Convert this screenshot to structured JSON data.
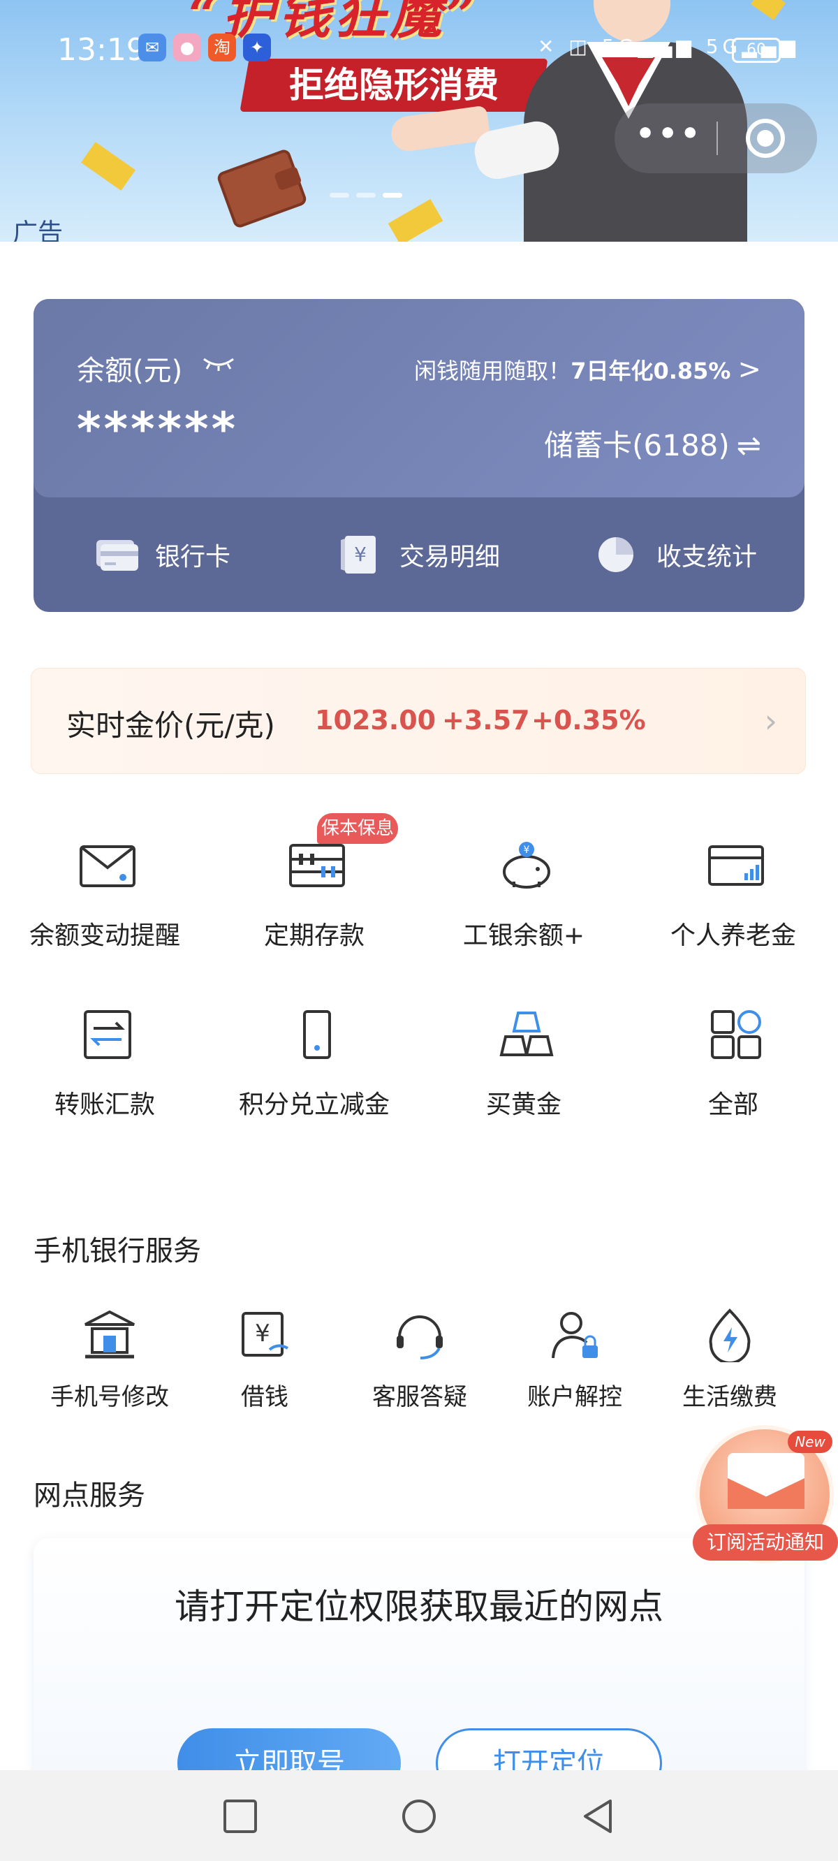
{
  "status_bar": {
    "time": "13:19",
    "battery": "60"
  },
  "banner": {
    "title": "“护钱狂魔”",
    "tagline": "拒绝隐形消费",
    "ad_label": "广告"
  },
  "balance_card": {
    "balance_label": "余额(元)",
    "balance_hidden": "******",
    "promo_text": "闲钱随用随取！",
    "promo_rate": "7日年化0.85%",
    "promo_arrow": ">",
    "account": "储蓄卡(6188)",
    "swap_symbol": "⇌",
    "actions": [
      {
        "label": "银行卡",
        "icon": "bank-card-icon"
      },
      {
        "label": "交易明细",
        "icon": "transaction-detail-icon"
      },
      {
        "label": "收支统计",
        "icon": "pie-chart-icon"
      }
    ]
  },
  "gold_price": {
    "label": "实时金价(元/克)",
    "price": "1023.00",
    "change": "+3.57",
    "percent": "+0.35%"
  },
  "grid": {
    "badge": "保本保息",
    "items": [
      {
        "label": "余额变动提醒",
        "icon": "envelope-icon"
      },
      {
        "label": "定期存款",
        "icon": "abacus-icon"
      },
      {
        "label": "工银余额+",
        "icon": "piggy-bank-icon"
      },
      {
        "label": "个人养老金",
        "icon": "pension-card-icon"
      },
      {
        "label": "转账汇款",
        "icon": "transfer-icon"
      },
      {
        "label": "积分兑立减金",
        "icon": "phone-icon"
      },
      {
        "label": "买黄金",
        "icon": "gold-bars-icon"
      },
      {
        "label": "全部",
        "icon": "all-apps-icon"
      }
    ]
  },
  "mobile_services": {
    "title": "手机银行服务",
    "items": [
      {
        "label": "手机号修改",
        "icon": "bank-building-icon"
      },
      {
        "label": "借钱",
        "icon": "loan-icon"
      },
      {
        "label": "客服答疑",
        "icon": "headset-icon"
      },
      {
        "label": "账户解控",
        "icon": "user-lock-icon"
      },
      {
        "label": "生活缴费",
        "icon": "lightning-icon"
      }
    ]
  },
  "branch_services": {
    "title": "网点服务",
    "message": "请打开定位权限获取最近的网点",
    "primary_button": "立即取号",
    "secondary_button": "打开定位"
  },
  "floating": {
    "label": "订阅活动通知",
    "new_badge": "New"
  },
  "colors": {
    "accent_blue": "#3f8ee8",
    "gold_red": "#d9534f",
    "card": "#6b79a8"
  }
}
